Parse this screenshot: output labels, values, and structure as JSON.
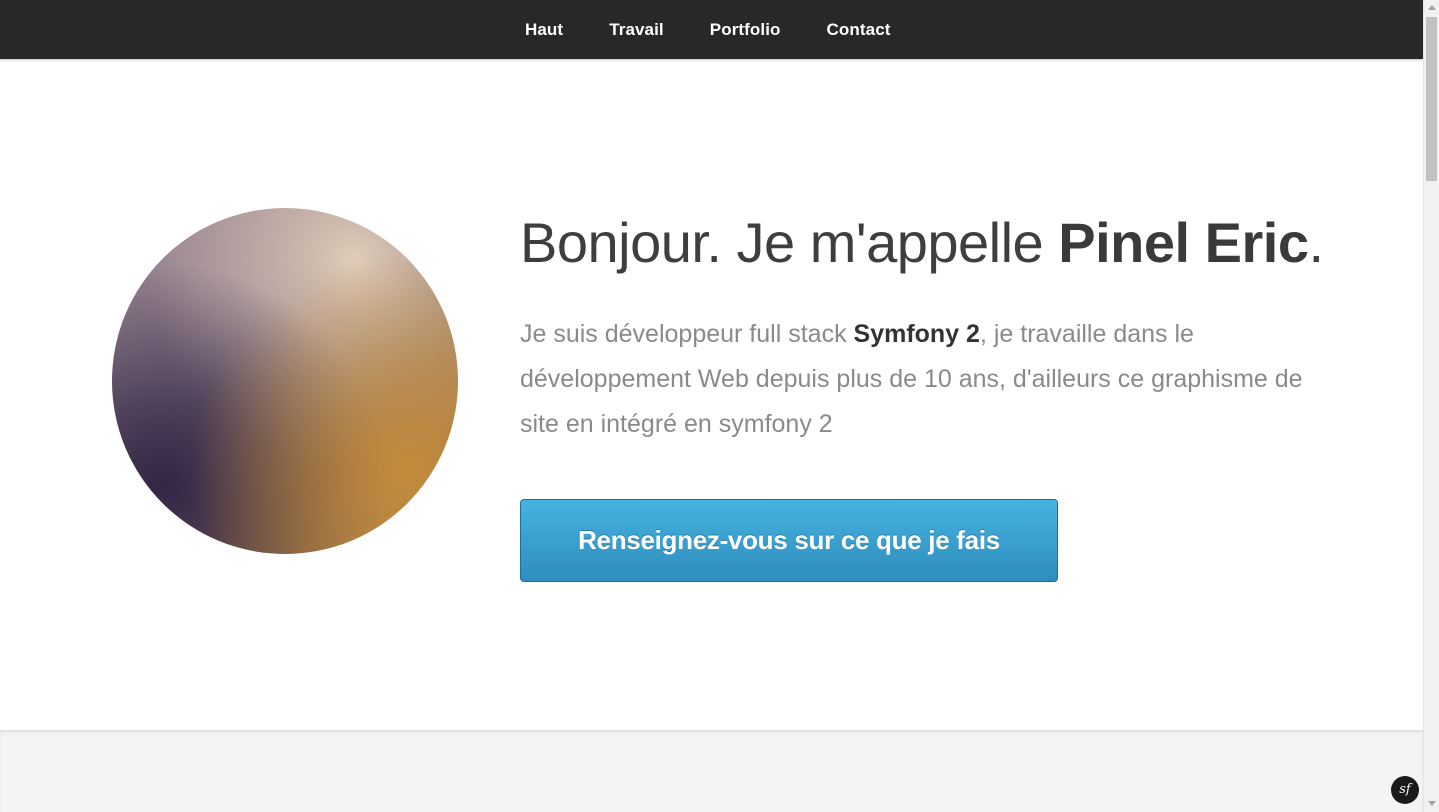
{
  "nav": {
    "items": [
      {
        "label": "Haut"
      },
      {
        "label": "Travail"
      },
      {
        "label": "Portfolio"
      },
      {
        "label": "Contact"
      }
    ]
  },
  "hero": {
    "title_prefix": "Bonjour. Je m'appelle ",
    "title_name": "Pinel Eric",
    "title_suffix": ".",
    "text_part1": "Je suis développeur full stack ",
    "text_highlight": "Symfony 2",
    "text_part2": ", je travaille dans le développement Web depuis plus de 10 ans, d'ailleurs ce graphisme de site en intégré en symfony 2",
    "cta_label": "Renseignez-vous sur ce que je fais"
  },
  "badge": {
    "label": "sf",
    "icon": "symfony-logo-icon"
  },
  "colors": {
    "nav_background": "#282828",
    "cta_top": "#45b3e0",
    "cta_bottom": "#2e8dbd"
  }
}
